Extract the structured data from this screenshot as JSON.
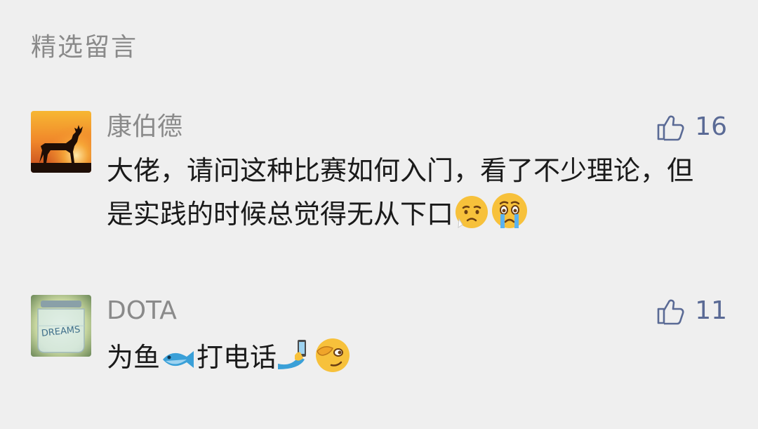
{
  "section": {
    "title": "精选留言"
  },
  "comments": [
    {
      "username": "康伯德",
      "likes": "16",
      "text": "大佬，请问这种比赛如何入门，看了不少理论，但是实践的时候总觉得无从下口",
      "emojis": [
        "worried-face-emoji",
        "crying-face-emoji"
      ],
      "avatar": "deer-silhouette-sunset"
    },
    {
      "username": "DOTA",
      "likes": "11",
      "text_parts": [
        "为鱼",
        "打电话"
      ],
      "emojis": [
        "fish-emoji",
        "phone-call-hand-emoji",
        "smirk-face-emoji"
      ],
      "avatar": "dreams-jar"
    }
  ],
  "colors": {
    "background": "#efefef",
    "meta_text": "#8a8a8a",
    "like_accent": "#5a6a95",
    "body_text": "#1a1a1a"
  }
}
